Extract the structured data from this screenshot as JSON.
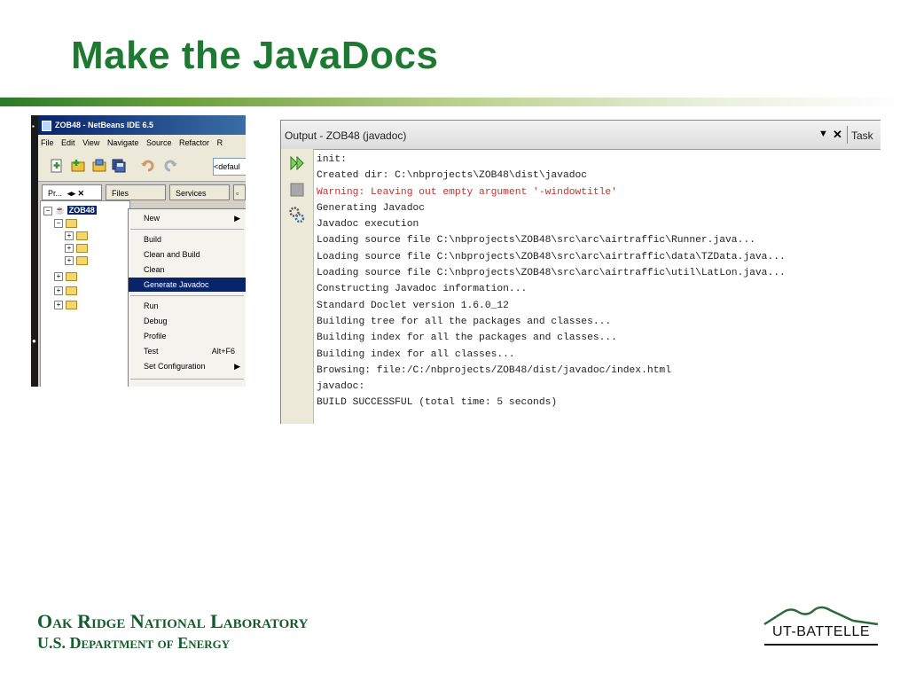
{
  "slide": {
    "title": "Make the JavaDocs"
  },
  "netbeans": {
    "window_title": "ZOB48 - NetBeans IDE 6.5",
    "menus": [
      "File",
      "Edit",
      "View",
      "Navigate",
      "Source",
      "Refactor",
      "R"
    ],
    "config_combo": "<defaul",
    "tabs": {
      "projects": "Pr...",
      "files": "Files",
      "services": "Services"
    },
    "root_node": "ZOB48",
    "context_menu": {
      "new": "New",
      "build": "Build",
      "clean_build": "Clean and Build",
      "clean": "Clean",
      "generate_javadoc": "Generate Javadoc",
      "run": "Run",
      "debug": "Debug",
      "profile": "Profile",
      "test": "Test",
      "test_shortcut": "Alt+F6",
      "set_configuration": "Set Configuration"
    }
  },
  "output": {
    "title": "Output - ZOB48 (javadoc)",
    "other_tab": "Task",
    "lines": [
      "init:",
      "Created dir: C:\\nbprojects\\ZOB48\\dist\\javadoc",
      "Warning: Leaving out empty argument '-windowtitle'",
      "Generating Javadoc",
      "Javadoc execution",
      "Loading source file C:\\nbprojects\\ZOB48\\src\\arc\\airtraffic\\Runner.java...",
      "Loading source file C:\\nbprojects\\ZOB48\\src\\arc\\airtraffic\\data\\TZData.java...",
      "Loading source file C:\\nbprojects\\ZOB48\\src\\arc\\airtraffic\\util\\LatLon.java...",
      "Constructing Javadoc information...",
      "Standard Doclet version 1.6.0_12",
      "Building tree for all the packages and classes...",
      "Building index for all the packages and classes...",
      "Building index for all classes...",
      "Browsing: file:/C:/nbprojects/ZOB48/dist/javadoc/index.html",
      "javadoc:",
      "BUILD SUCCESSFUL (total time: 5 seconds)"
    ]
  },
  "footer": {
    "lab_name": "Oak Ridge National Laboratory",
    "department": "U.S. Department of Energy",
    "logo_text": "UT-BATTELLE"
  },
  "colors": {
    "title_green": "#1e7a33",
    "footer_green": "#145c2b",
    "selection_blue": "#0a246a",
    "warning_red": "#c0322e"
  }
}
